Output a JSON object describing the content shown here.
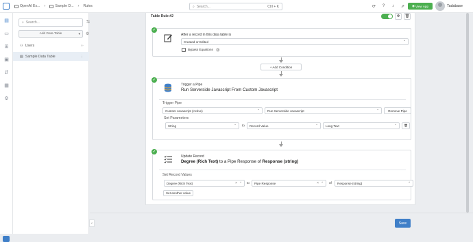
{
  "topbar": {
    "crumbs": [
      "OpenAI Ex...",
      "Sample D...",
      "Rules"
    ],
    "search_placeholder": "Search...",
    "search_shortcut": "Ctrl + K",
    "view_app_label": "View App",
    "user_name": "Tadabase"
  },
  "sidebar": {
    "search_placeholder": "Search...",
    "add_table_label": "Add Data Table",
    "items": [
      {
        "label": "Users"
      },
      {
        "label": "Sample Data Table"
      }
    ]
  },
  "rule": {
    "title": "Table Rule #2",
    "enabled": true,
    "trigger": {
      "title": "After a record in this data table is",
      "event_value": "Created or Edited",
      "bypass_label": "Bypass Equations"
    },
    "add_condition_label": "+ Add Condition",
    "pipe_action": {
      "title": "Trigger a Pipe",
      "main": "Run Serverside Javascript From Custom Javascript",
      "trigger_pipe_label": "Trigger Pipe",
      "pipe_value": "Custom Javascript (Active)",
      "function_value": "Run Serverside Javascript",
      "remove_pipe_label": "Remove Pipe",
      "set_params_label": "Set Parameters",
      "param_name": "String",
      "to_label": "to",
      "param_source": "Record Value",
      "param_field": "Long Text"
    },
    "update_action": {
      "title": "Update Record",
      "main_bold_1": "Degree (Rich Text)",
      "main_mid": " to a Pipe Response of ",
      "main_bold_2": "Response (string)",
      "set_values_label": "Set Record Values",
      "field_value": "Degree (Rich Text)",
      "to_label": "to",
      "source_value": "Pipe Response",
      "of_label": "of",
      "response_value": "Response (string)",
      "set_another_label": "Set another value"
    }
  },
  "footer": {
    "save_label": "Save"
  },
  "colors": {
    "accent": "#3f7fc8",
    "success": "#4caf50"
  }
}
